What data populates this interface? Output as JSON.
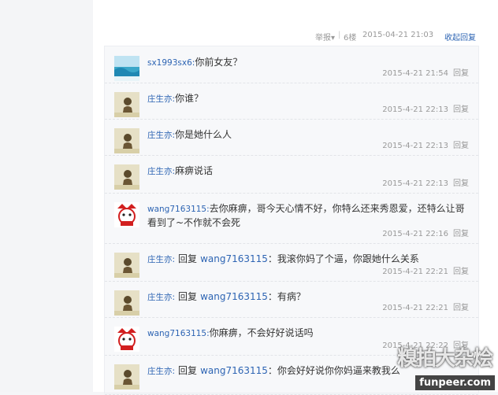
{
  "floor_bar": {
    "report": "举报",
    "sep": "|",
    "floor": "6楼",
    "time": "2015-04-21 21:03",
    "collapse": "收起回复"
  },
  "replies": [
    {
      "user": "sx1993sx6:",
      "ref_prefix": "",
      "ref_user": "",
      "text": "你前女友？",
      "time": "2015-4-21 21:54",
      "reply": "回复",
      "avatar": "sea"
    },
    {
      "user": "庄生亦:",
      "ref_prefix": "",
      "ref_user": "",
      "text": "你谁？",
      "time": "2015-4-21 22:13",
      "reply": "回复",
      "avatar": "person"
    },
    {
      "user": "庄生亦:",
      "ref_prefix": "",
      "ref_user": "",
      "text": "你是她什么人",
      "time": "2015-4-21 22:13",
      "reply": "回复",
      "avatar": "person"
    },
    {
      "user": "庄生亦:",
      "ref_prefix": "",
      "ref_user": "",
      "text": "麻痹说话",
      "time": "2015-4-21 22:13",
      "reply": "回复",
      "avatar": "person"
    },
    {
      "user": "wang7163115:",
      "ref_prefix": "",
      "ref_user": "",
      "text": "去你麻痹，哥今天心情不好，你特么还来秀恩爱，还特么让哥看到了~不作就不会死",
      "time": "2015-4-21 22:16",
      "reply": "回复",
      "avatar": "cartoon"
    },
    {
      "user": "庄生亦:",
      "ref_prefix": "回复",
      "ref_user": "wang7163115",
      "text": "：我滚你妈了个逼，你跟她什么关系",
      "time": "2015-4-21 22:21",
      "reply": "回复",
      "avatar": "person"
    },
    {
      "user": "庄生亦:",
      "ref_prefix": "回复",
      "ref_user": "wang7163115",
      "text": "：有病？",
      "time": "2015-4-21 22:21",
      "reply": "回复",
      "avatar": "person"
    },
    {
      "user": "wang7163115:",
      "ref_prefix": "",
      "ref_user": "",
      "text": "你麻痹，不会好好说话吗",
      "time": "2015-4-21 22:22",
      "reply": "回复",
      "avatar": "cartoon"
    },
    {
      "user": "庄生亦:",
      "ref_prefix": "回复",
      "ref_user": "wang7163115",
      "text": "：你会好好说你你妈逼来教我么",
      "time": "",
      "reply": "",
      "avatar": "person"
    }
  ],
  "watermark": {
    "text": "糗拍大杂烩",
    "url": "funpeer.com"
  }
}
